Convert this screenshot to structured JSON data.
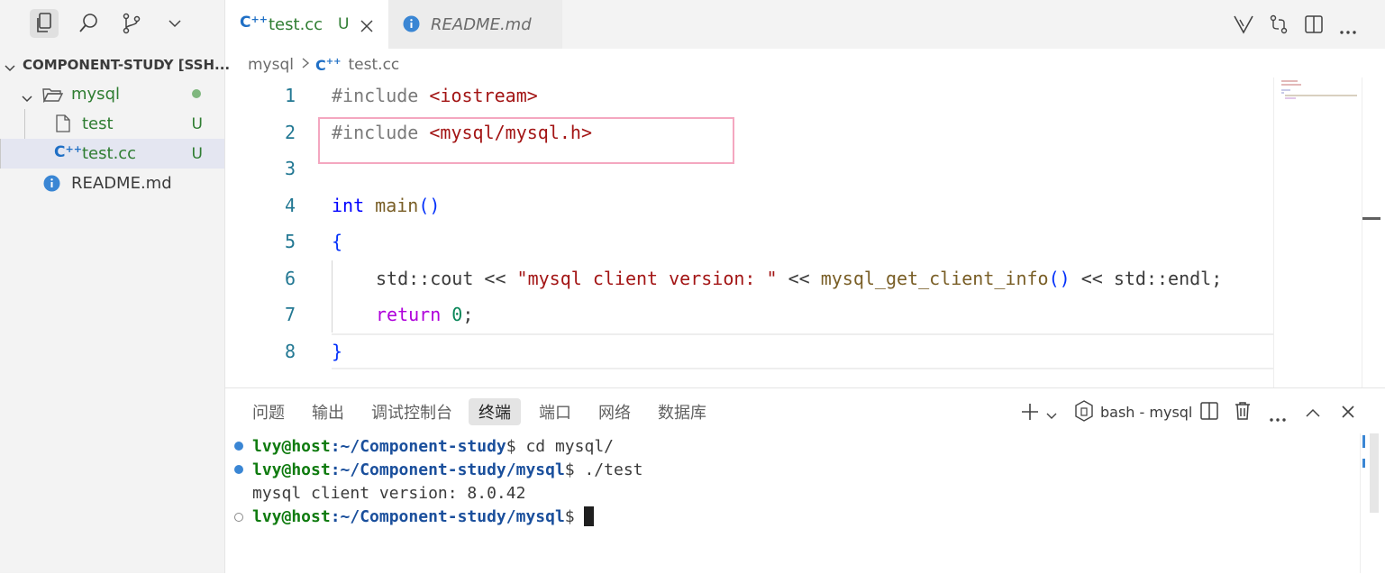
{
  "explorer": {
    "root_label": "COMPONENT-STUDY [SSH...",
    "items": [
      {
        "label": "mysql",
        "type": "folder"
      },
      {
        "label": "test",
        "badge": "U",
        "type": "file"
      },
      {
        "label": "test.cc",
        "badge": "U",
        "type": "cpp"
      },
      {
        "label": "README.md",
        "type": "info"
      }
    ]
  },
  "tabs": [
    {
      "label": "test.cc",
      "badge": "U"
    },
    {
      "label": "README.md"
    }
  ],
  "breadcrumb": {
    "folder": "mysql",
    "file": "test.cc"
  },
  "editor": {
    "line_numbers": [
      "1",
      "2",
      "3",
      "4",
      "5",
      "6",
      "7",
      "8"
    ],
    "lines": {
      "l1": {
        "pre": "#include ",
        "str": "<iostream>"
      },
      "l2": {
        "pre": "#include ",
        "str": "<mysql/mysql.h>"
      },
      "l4": {
        "kw": "int",
        "fn": "main",
        "paren": "()"
      },
      "l5": {
        "brace": "{"
      },
      "l6": {
        "a": "std::cout << ",
        "str": "\"mysql client version: \"",
        "b": " << ",
        "fn": "mysql_get_client_info",
        "paren": "()",
        "c": " << std::endl;"
      },
      "l7": {
        "ctl": "return",
        "num": "0",
        "semi": ";"
      },
      "l8": {
        "brace": "}"
      }
    }
  },
  "panel": {
    "tabs": [
      "问题",
      "输出",
      "调试控制台",
      "终端",
      "端口",
      "网络",
      "数据库"
    ],
    "terminal_label": "bash - mysql",
    "terminal": [
      {
        "user": "lvy@host",
        "path": ":~/Component-study",
        "cmd": "$ cd mysql/"
      },
      {
        "user": "lvy@host",
        "path": ":~/Component-study/mysql",
        "cmd": "$ ./test"
      },
      {
        "output": "mysql client version: 8.0.42"
      },
      {
        "user": "lvy@host",
        "path": ":~/Component-study/mysql",
        "cmd": "$ "
      }
    ]
  },
  "colors": {
    "highlight_box": "#f4a7c0",
    "cpp_icon": "#1f6fc5",
    "untracked": "#2f7d32"
  }
}
